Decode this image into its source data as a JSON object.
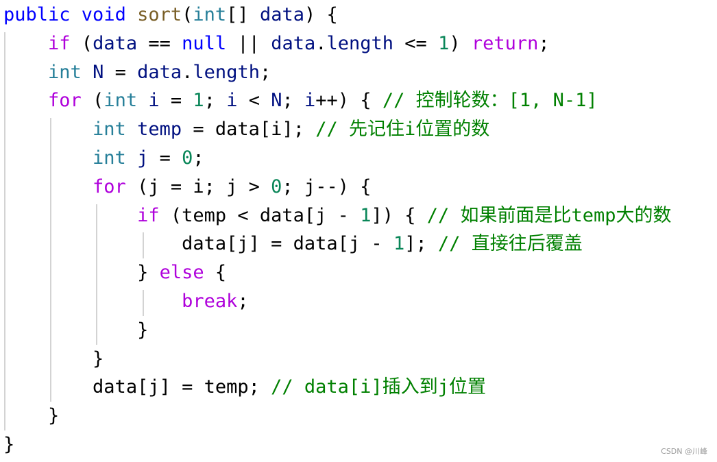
{
  "editor": {
    "language": "java",
    "lines": [
      {
        "indent": 0,
        "tokens": [
          [
            "kw",
            "public"
          ],
          [
            "",
            ""
          ],
          [
            "kw",
            " void"
          ],
          [
            "",
            " "
          ],
          [
            "fn",
            "sort"
          ],
          [
            "",
            "("
          ],
          [
            "type",
            "int"
          ],
          [
            "",
            "[] "
          ],
          [
            "var",
            "data"
          ],
          [
            "",
            ") {"
          ]
        ]
      },
      {
        "indent": 1,
        "tokens": [
          [
            "ctl",
            "if"
          ],
          [
            "",
            " ("
          ],
          [
            "var",
            "data"
          ],
          [
            "",
            " == "
          ],
          [
            "kw",
            "null"
          ],
          [
            "",
            " || "
          ],
          [
            "var",
            "data"
          ],
          [
            "",
            "."
          ],
          [
            "var",
            "length"
          ],
          [
            "",
            " <= "
          ],
          [
            "num",
            "1"
          ],
          [
            "",
            ") "
          ],
          [
            "ctl",
            "return"
          ],
          [
            "",
            ";"
          ]
        ]
      },
      {
        "indent": 1,
        "tokens": [
          [
            "type",
            "int"
          ],
          [
            "",
            " "
          ],
          [
            "var",
            "N"
          ],
          [
            "",
            " = "
          ],
          [
            "var",
            "data"
          ],
          [
            "",
            "."
          ],
          [
            "var",
            "length"
          ],
          [
            "",
            ";"
          ]
        ]
      },
      {
        "indent": 1,
        "tokens": [
          [
            "ctl",
            "for"
          ],
          [
            "",
            " ("
          ],
          [
            "type",
            "int"
          ],
          [
            "",
            " "
          ],
          [
            "var",
            "i"
          ],
          [
            "",
            " = "
          ],
          [
            "num",
            "1"
          ],
          [
            "",
            "; "
          ],
          [
            "var",
            "i"
          ],
          [
            "",
            " < "
          ],
          [
            "var",
            "N"
          ],
          [
            "",
            "; "
          ],
          [
            "var",
            "i"
          ],
          [
            "",
            "++) { "
          ],
          [
            "cm",
            "// 控制轮数：[1, N-1]"
          ]
        ]
      },
      {
        "indent": 2,
        "tokens": [
          [
            "type",
            "int"
          ],
          [
            "",
            " "
          ],
          [
            "var",
            "temp"
          ],
          [
            "",
            " = "
          ],
          [
            "",
            "data[i]; "
          ],
          [
            "cm",
            "// 先记住i位置的数"
          ]
        ]
      },
      {
        "indent": 2,
        "tokens": [
          [
            "type",
            "int"
          ],
          [
            "",
            " "
          ],
          [
            "var",
            "j"
          ],
          [
            "",
            " = "
          ],
          [
            "num",
            "0"
          ],
          [
            "",
            ";"
          ]
        ]
      },
      {
        "indent": 2,
        "tokens": [
          [
            "ctl",
            "for"
          ],
          [
            "",
            " (j = i; j > "
          ],
          [
            "num",
            "0"
          ],
          [
            "",
            "; j--) {"
          ]
        ]
      },
      {
        "indent": 3,
        "tokens": [
          [
            "ctl",
            "if"
          ],
          [
            "",
            " (temp < data[j - "
          ],
          [
            "num",
            "1"
          ],
          [
            "",
            "]) { "
          ],
          [
            "cm",
            "// 如果前面是比temp大的数"
          ]
        ]
      },
      {
        "indent": 4,
        "tokens": [
          [
            "",
            "data[j] = data[j - "
          ],
          [
            "num",
            "1"
          ],
          [
            "",
            "]; "
          ],
          [
            "cm",
            "// 直接往后覆盖"
          ]
        ]
      },
      {
        "indent": 3,
        "tokens": [
          [
            "",
            "} "
          ],
          [
            "ctl",
            "else"
          ],
          [
            "",
            " {"
          ]
        ]
      },
      {
        "indent": 4,
        "tokens": [
          [
            "ctl",
            "break"
          ],
          [
            "",
            ";"
          ]
        ]
      },
      {
        "indent": 3,
        "tokens": [
          [
            "",
            "}"
          ]
        ]
      },
      {
        "indent": 2,
        "tokens": [
          [
            "",
            "}"
          ]
        ]
      },
      {
        "indent": 2,
        "tokens": [
          [
            "",
            "data[j] = temp; "
          ],
          [
            "cm",
            "// data[i]插入到j位置"
          ]
        ]
      },
      {
        "indent": 1,
        "tokens": [
          [
            "",
            "}"
          ]
        ]
      },
      {
        "indent": 0,
        "tokens": [
          [
            "",
            "}"
          ]
        ]
      }
    ]
  },
  "watermark": "CSDN @川峰"
}
